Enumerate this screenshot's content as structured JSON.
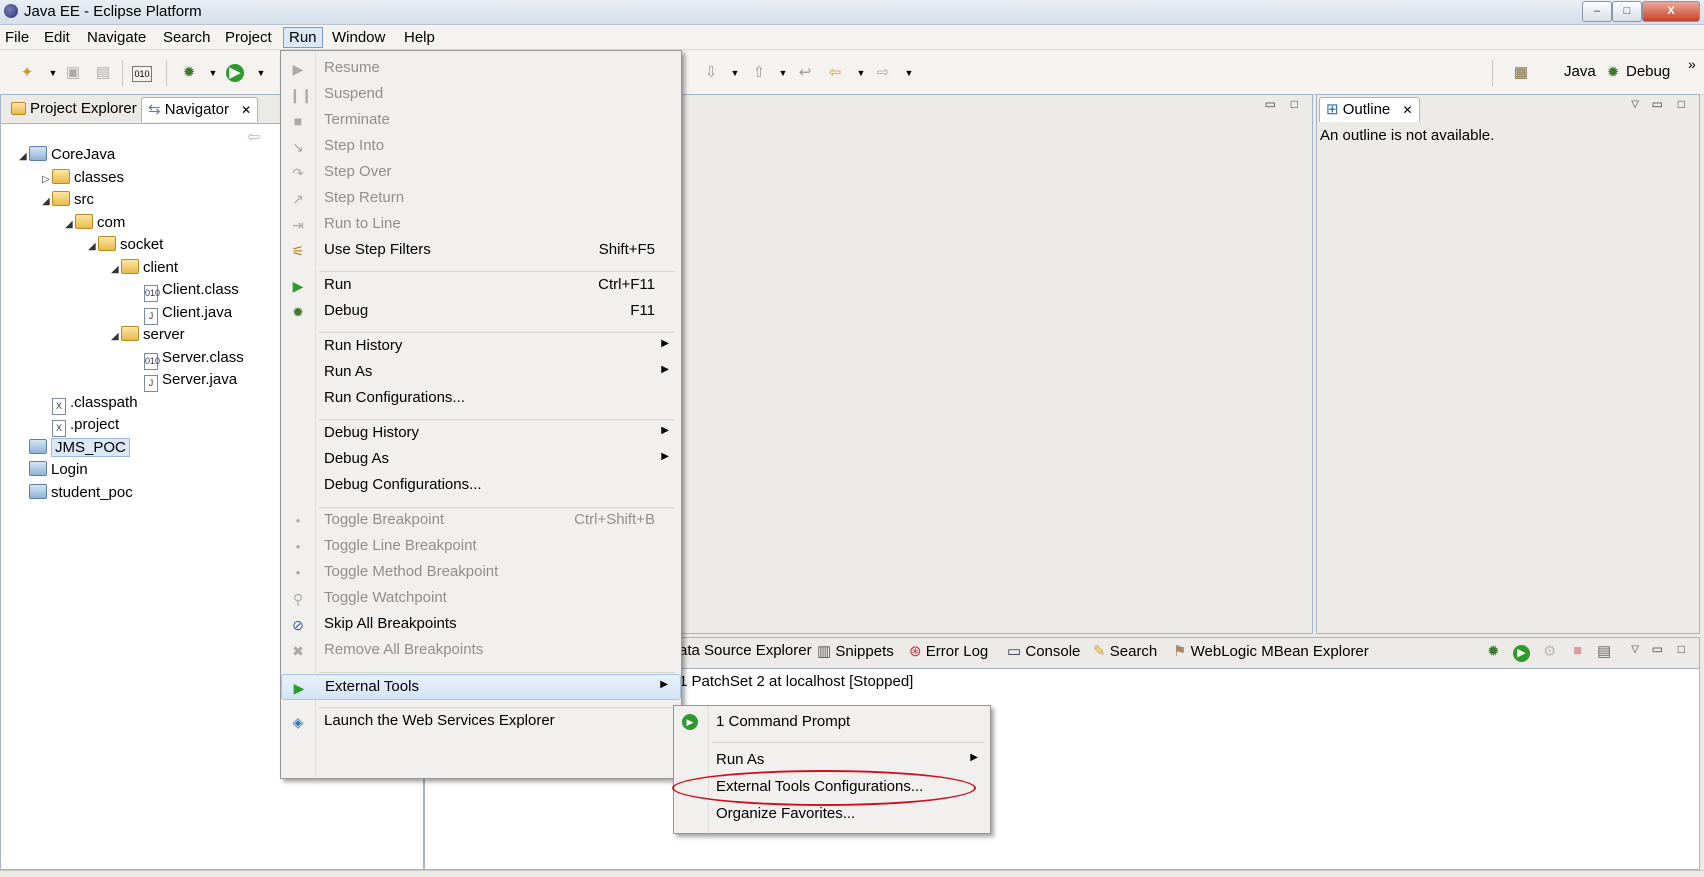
{
  "window": {
    "title": "Java EE - Eclipse Platform",
    "min": "‒",
    "max": "□",
    "close": "X"
  },
  "menubar": [
    "File",
    "Edit",
    "Navigate",
    "Search",
    "Project",
    "Run",
    "Window",
    "Help"
  ],
  "perspectives": {
    "java": "Java",
    "debug": "Debug",
    "more": "»"
  },
  "left_panel": {
    "tabs": [
      "Project Explorer",
      "Navigator"
    ],
    "tab_close": "✕",
    "tree": [
      {
        "label": "CoreJava",
        "icon": "project-icon",
        "depth": 0,
        "twisty": "◢"
      },
      {
        "label": "classes",
        "icon": "folder-icon",
        "depth": 1,
        "twisty": "▷"
      },
      {
        "label": "src",
        "icon": "folder-icon",
        "depth": 1,
        "twisty": "◢"
      },
      {
        "label": "com",
        "icon": "folder-icon",
        "depth": 2,
        "twisty": "◢"
      },
      {
        "label": "socket",
        "icon": "folder-icon",
        "depth": 3,
        "twisty": "◢"
      },
      {
        "label": "client",
        "icon": "folder-icon",
        "depth": 4,
        "twisty": "◢"
      },
      {
        "label": "Client.class",
        "icon": "class-file-icon",
        "depth": 5,
        "twisty": ""
      },
      {
        "label": "Client.java",
        "icon": "java-file-icon",
        "depth": 5,
        "twisty": ""
      },
      {
        "label": "server",
        "icon": "folder-icon",
        "depth": 4,
        "twisty": "◢"
      },
      {
        "label": "Server.class",
        "icon": "class-file-icon",
        "depth": 5,
        "twisty": ""
      },
      {
        "label": "Server.java",
        "icon": "java-file-icon",
        "depth": 5,
        "twisty": ""
      },
      {
        "label": ".classpath",
        "icon": "xml-file-icon",
        "depth": 1,
        "twisty": ""
      },
      {
        "label": ".project",
        "icon": "xml-file-icon",
        "depth": 1,
        "twisty": ""
      },
      {
        "label": "JMS_POC",
        "icon": "closed-project-icon",
        "depth": 0,
        "twisty": "",
        "selected": true
      },
      {
        "label": "Login",
        "icon": "closed-project-icon",
        "depth": 0,
        "twisty": ""
      },
      {
        "label": "student_poc",
        "icon": "closed-project-icon",
        "depth": 0,
        "twisty": ""
      }
    ]
  },
  "outline": {
    "tab": "Outline",
    "message": "An outline is not available."
  },
  "bottom_panel": {
    "tabs": [
      "ata Source Explorer",
      "Snippets",
      "Error Log",
      "Console",
      "Search",
      "WebLogic MBean Explorer"
    ],
    "server_line": "1 PatchSet 2 at localhost  [Stopped]"
  },
  "run_menu": {
    "items": [
      {
        "label": "Resume",
        "shortcut": "",
        "disabled": true,
        "icon": "resume-icon"
      },
      {
        "label": "Suspend",
        "shortcut": "",
        "disabled": true,
        "icon": "suspend-icon"
      },
      {
        "label": "Terminate",
        "shortcut": "",
        "disabled": true,
        "icon": "terminate-icon"
      },
      {
        "label": "Step Into",
        "shortcut": "",
        "disabled": true,
        "icon": "step-into-icon"
      },
      {
        "label": "Step Over",
        "shortcut": "",
        "disabled": true,
        "icon": "step-over-icon"
      },
      {
        "label": "Step Return",
        "shortcut": "",
        "disabled": true,
        "icon": "step-return-icon"
      },
      {
        "label": "Run to Line",
        "shortcut": "",
        "disabled": true,
        "icon": "run-to-line-icon"
      },
      {
        "label": "Use Step Filters",
        "shortcut": "Shift+F5",
        "disabled": false,
        "icon": "step-filters-icon"
      },
      {
        "label": "Run",
        "shortcut": "Ctrl+F11",
        "disabled": false,
        "icon": "run-icon"
      },
      {
        "label": "Debug",
        "shortcut": "F11",
        "disabled": false,
        "icon": "debug-icon"
      },
      {
        "label": "Run History",
        "shortcut": "",
        "disabled": false,
        "submenu": true
      },
      {
        "label": "Run As",
        "shortcut": "",
        "disabled": false,
        "submenu": true
      },
      {
        "label": "Run Configurations...",
        "shortcut": "",
        "disabled": false
      },
      {
        "label": "Debug History",
        "shortcut": "",
        "disabled": false,
        "submenu": true
      },
      {
        "label": "Debug As",
        "shortcut": "",
        "disabled": false,
        "submenu": true
      },
      {
        "label": "Debug Configurations...",
        "shortcut": "",
        "disabled": false
      },
      {
        "label": "Toggle Breakpoint",
        "shortcut": "Ctrl+Shift+B",
        "disabled": true,
        "icon": "breakpoint-icon"
      },
      {
        "label": "Toggle Line Breakpoint",
        "shortcut": "",
        "disabled": true,
        "icon": "breakpoint-icon"
      },
      {
        "label": "Toggle Method Breakpoint",
        "shortcut": "",
        "disabled": true,
        "icon": "breakpoint-icon"
      },
      {
        "label": "Toggle Watchpoint",
        "shortcut": "",
        "disabled": true,
        "icon": "watchpoint-icon"
      },
      {
        "label": "Skip All Breakpoints",
        "shortcut": "",
        "disabled": false,
        "icon": "skip-breakpoints-icon"
      },
      {
        "label": "Remove All Breakpoints",
        "shortcut": "",
        "disabled": true,
        "icon": "remove-breakpoints-icon"
      },
      {
        "label": "External Tools",
        "shortcut": "",
        "disabled": false,
        "submenu": true,
        "highlighted": true,
        "icon": "external-tools-icon"
      },
      {
        "label": "Launch the Web Services Explorer",
        "shortcut": "",
        "disabled": false,
        "icon": "web-services-icon"
      }
    ]
  },
  "external_tools_submenu": {
    "items": [
      {
        "label": "1 Command Prompt",
        "icon": "external-tools-icon"
      },
      {
        "label": "Run As",
        "submenu": true
      },
      {
        "label": "External Tools Configurations...",
        "circled": true
      },
      {
        "label": "Organize Favorites..."
      }
    ]
  }
}
